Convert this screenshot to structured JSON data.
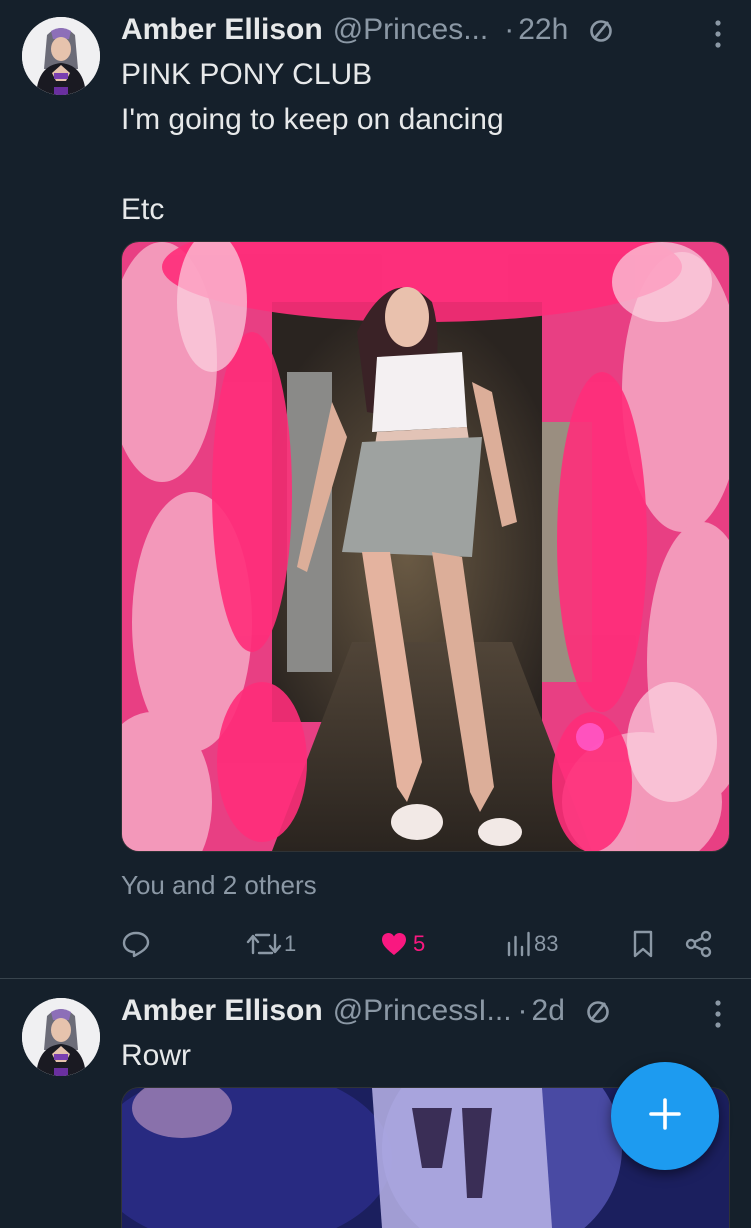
{
  "tweets": [
    {
      "author_name": "Amber Ellison",
      "handle": "@Princes...",
      "separator": "·",
      "time": "22h",
      "lines": [
        "PINK PONY CLUB",
        "I'm going to keep on dancing",
        "",
        "Etc"
      ],
      "social_context": "You and 2 others",
      "actions": {
        "replies": "",
        "retweets": "1",
        "likes": "5",
        "views": "83"
      },
      "colors": {
        "like_active": "#f91880"
      }
    },
    {
      "author_name": "Amber Ellison",
      "handle": "@PrincessI...",
      "separator": "·",
      "time": "2d",
      "lines": [
        "Rowr"
      ]
    }
  ],
  "fab": {
    "icon": "plus-icon",
    "color": "#1d9bf0"
  },
  "icons": [
    "reply-icon",
    "retweet-icon",
    "like-icon",
    "views-icon",
    "bookmark-icon",
    "share-icon",
    "more-icon",
    "no-sign-icon"
  ]
}
